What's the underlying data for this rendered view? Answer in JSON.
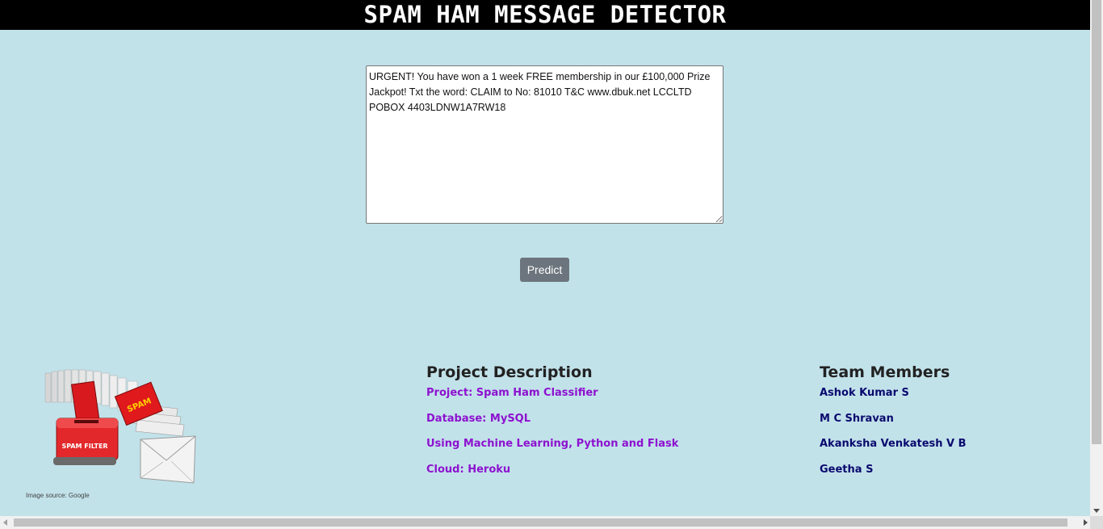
{
  "header": {
    "title": "SPAM HAM MESSAGE DETECTOR"
  },
  "form": {
    "message_value": "URGENT! You have won a 1 week FREE membership in our £100,000 Prize Jackpot! Txt the word: CLAIM to No: 81010 T&C www.dbuk.net LCCLTD POBOX 4403LDNW1A7RW18",
    "predict_label": "Predict"
  },
  "illustration": {
    "icon": "spam-filter-illustration",
    "box_label": "SPAM FILTER",
    "tag_label": "SPAM",
    "source_caption": "Image source: Google"
  },
  "project": {
    "heading": "Project Description",
    "items": [
      "Project: Spam Ham Classifier",
      "Database: MySQL",
      "Using Machine Learning, Python and Flask",
      "Cloud: Heroku"
    ]
  },
  "team": {
    "heading": "Team Members",
    "members": [
      "Ashok Kumar S",
      "M C Shravan",
      "Akanksha Venkatesh V B",
      "Geetha S"
    ]
  },
  "colors": {
    "background": "#c2e2ea",
    "header_bg": "#000000",
    "button_bg": "#6c757d",
    "project_text": "#8d12cf",
    "team_text": "#0a0a6e"
  }
}
